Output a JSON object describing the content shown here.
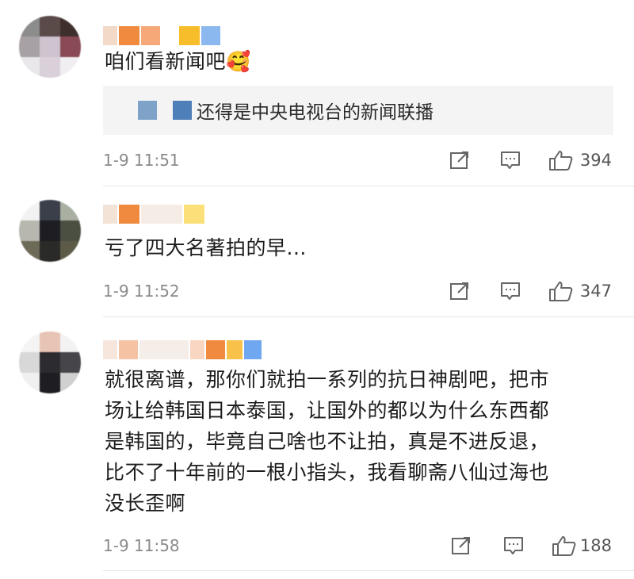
{
  "comments": [
    {
      "text": "咱们看新闻吧🥰",
      "reply": {
        "text": "还得是中央电视台的新闻联播"
      },
      "time": "1-9 11:51",
      "likes": "394"
    },
    {
      "text": "亏了四大名著拍的早...",
      "time": "1-9 11:52",
      "likes": "347"
    },
    {
      "text_lines": [
        "就很离谱，那你们就拍一系列的抗日神剧吧，把市",
        "场让给韩国日本泰国，让国外的都以为什么东西都",
        "是韩国的，毕竟自己啥也不让拍，真是不进反退，",
        "比不了十年前的一根小指头，我看聊斋八仙过海也",
        "没长歪啊"
      ],
      "time": "1-9 11:58",
      "likes": "188"
    }
  ],
  "icons": {
    "share": "share-icon",
    "reply": "comment-icon",
    "like": "thumbs-up-icon"
  }
}
